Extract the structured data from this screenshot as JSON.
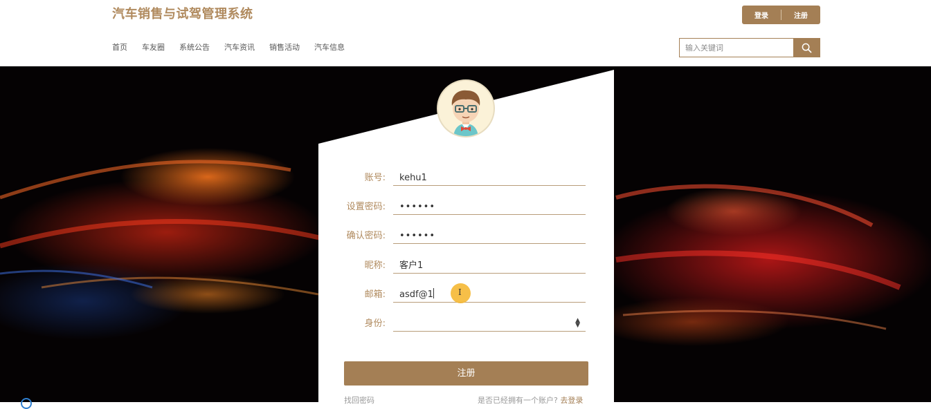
{
  "header": {
    "site_title": "汽车销售与试驾管理系统",
    "login_label": "登录",
    "register_label": "注册"
  },
  "nav": [
    "首页",
    "车友圈",
    "系统公告",
    "汽车资讯",
    "销售活动",
    "汽车信息"
  ],
  "search": {
    "placeholder": "输入关键词",
    "icon": "search-icon"
  },
  "form": {
    "account": {
      "label": "账号:",
      "value": "kehu1"
    },
    "password": {
      "label": "设置密码:",
      "value": "••••••"
    },
    "confirm_password": {
      "label": "确认密码:",
      "value": "••••••"
    },
    "nickname": {
      "label": "昵称:",
      "value": "客户1"
    },
    "email": {
      "label": "邮箱:",
      "value": "asdf@1"
    },
    "identity": {
      "label": "身份:",
      "value": ""
    },
    "submit_label": "注册",
    "forgot_label": "找回密码",
    "have_account_text": "是否已经拥有一个账户?",
    "go_login_label": "去登录"
  },
  "colors": {
    "accent": "#a47f55",
    "title": "#b08a5e"
  }
}
